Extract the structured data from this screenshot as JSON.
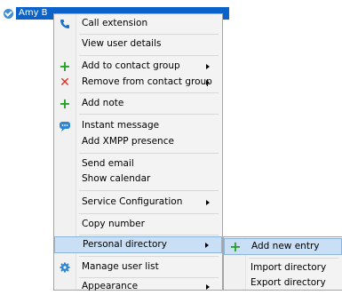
{
  "user": {
    "name": "Amy B"
  },
  "colors": {
    "accent": "#0b63c9",
    "highlight": "#c9dff5",
    "plus": "#2ca02c",
    "remove": "#d93025"
  },
  "menu": {
    "items": [
      {
        "label": "Call extension",
        "icon": "phone-icon"
      },
      {
        "label": "View user details"
      },
      {
        "label": "Add to contact group",
        "icon": "plus-icon"
      },
      {
        "label": "Remove from contact group",
        "icon": "x-icon"
      },
      {
        "label": "Add note",
        "icon": "plus-icon"
      },
      {
        "label": "Instant message",
        "icon": "chat-icon"
      },
      {
        "label": "Add XMPP presence"
      },
      {
        "label": "Send email"
      },
      {
        "label": "Show calendar"
      },
      {
        "label": "Service Configuration"
      },
      {
        "label": "Copy number"
      },
      {
        "label": "Personal directory"
      },
      {
        "label": "Manage user list",
        "icon": "gear-icon"
      },
      {
        "label": "Appearance"
      }
    ]
  },
  "submenu": {
    "items": [
      {
        "label": "Add new entry",
        "icon": "plus-icon"
      },
      {
        "label": "Import directory"
      },
      {
        "label": "Export directory"
      }
    ]
  }
}
